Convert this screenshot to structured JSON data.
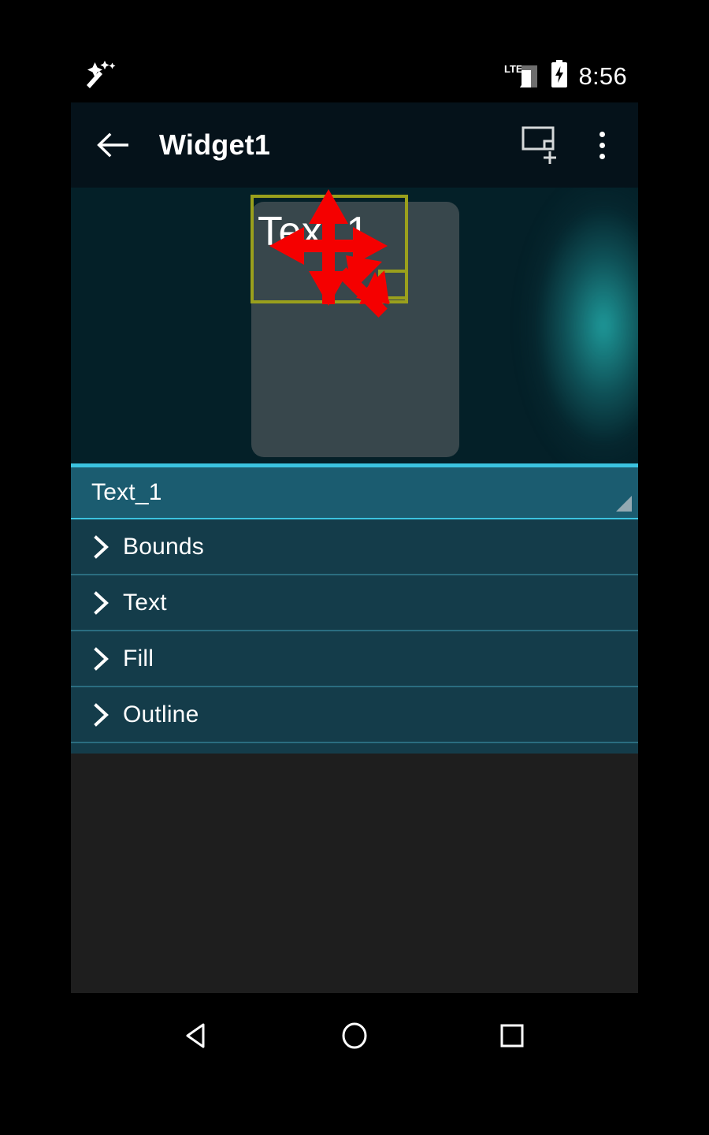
{
  "status_bar": {
    "notification_icon": "magic-wand-icon",
    "network_label": "LTE",
    "signal_icon": "signal-bars-icon",
    "battery_icon": "battery-charging-icon",
    "time": "8:56"
  },
  "app_bar": {
    "back_icon": "arrow-left-icon",
    "title": "Widget1",
    "add_element_icon": "add-element-icon",
    "overflow_icon": "more-vertical-icon"
  },
  "canvas": {
    "widget_text": "Text 1",
    "selection_color": "#9aa01c",
    "arrow_color": "#f50000",
    "card_color": "#38474c",
    "background_color": "#042028",
    "move_handle": "move-arrows-icon",
    "resize_handle": "resize-diagonal-icon"
  },
  "properties": {
    "selected_element": "Text_1",
    "spinner_indicator": "dropdown-triangle-icon",
    "rows": [
      {
        "label": "Bounds",
        "icon": "chevron-right-icon"
      },
      {
        "label": "Text",
        "icon": "chevron-right-icon"
      },
      {
        "label": "Fill",
        "icon": "chevron-right-icon"
      },
      {
        "label": "Outline",
        "icon": "chevron-right-icon"
      }
    ]
  },
  "nav_bar": {
    "back_icon": "nav-back-triangle-icon",
    "home_icon": "nav-home-circle-icon",
    "recents_icon": "nav-recents-square-icon"
  },
  "theme": {
    "accent": "#3bc3e0",
    "panel_header": "#1b5c70",
    "panel_row": "#143c4a",
    "empty": "#1e1e1e"
  }
}
